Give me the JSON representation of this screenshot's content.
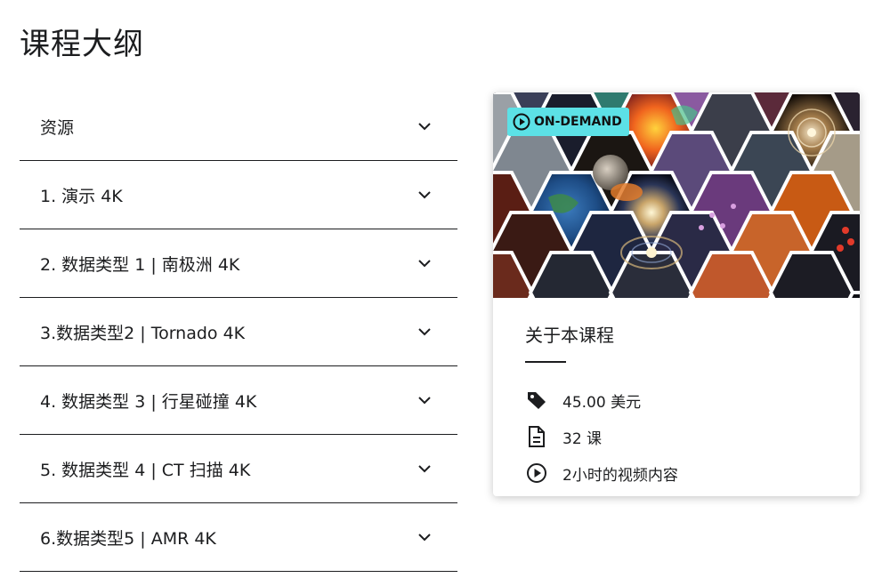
{
  "page": {
    "title": "课程大纲"
  },
  "curriculum": {
    "sections": [
      {
        "label": "资源"
      },
      {
        "label": "1. 演示 4K"
      },
      {
        "label": "2. 数据类型 1 | 南极洲 4K"
      },
      {
        "label": "3.数据类型2 | Tornado 4K"
      },
      {
        "label": "4. 数据类型 3 | 行星碰撞 4K"
      },
      {
        "label": "5. 数据类型 4 | CT 扫描 4K"
      },
      {
        "label": "6.数据类型5 | AMR 4K"
      }
    ]
  },
  "card": {
    "badge_label": "ON-DEMAND",
    "badge_color": "#5ce1e6",
    "title": "关于本课程",
    "price": "45.00 美元",
    "lessons": "32 课",
    "video": "2小时的视频内容",
    "icons": {
      "price": "price-tag-icon",
      "lessons": "document-icon",
      "video": "play-circle-icon"
    }
  }
}
